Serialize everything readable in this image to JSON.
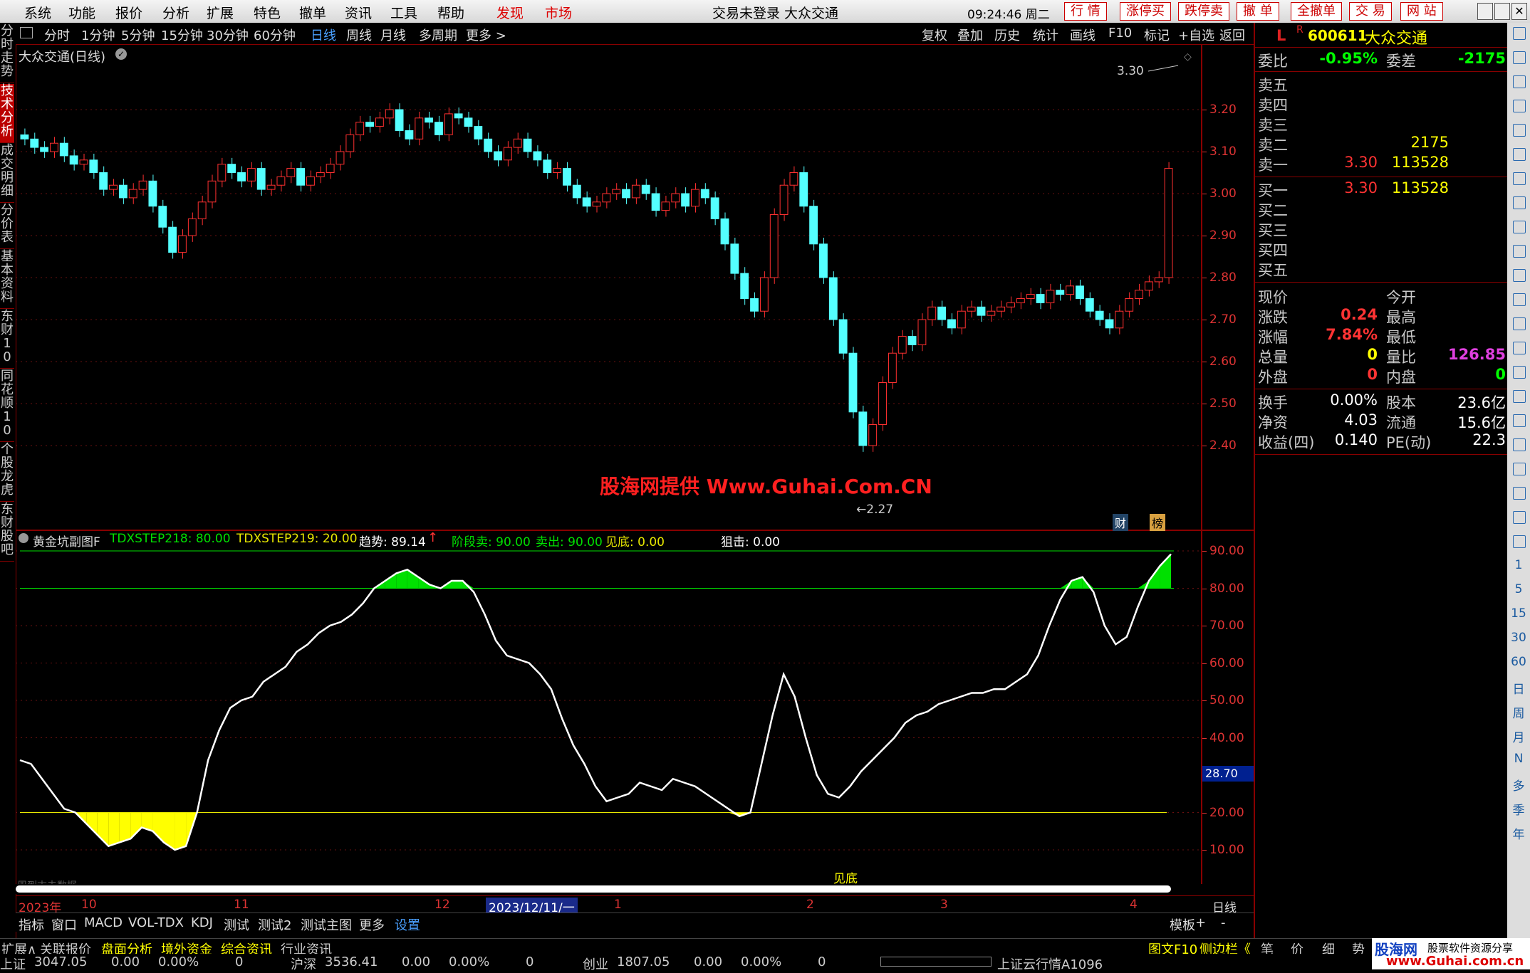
{
  "menu": {
    "items": [
      "系统",
      "功能",
      "报价",
      "分析",
      "扩展",
      "特色",
      "撤单",
      "资讯",
      "工具",
      "帮助"
    ],
    "highlight": [
      "发现",
      "市场"
    ],
    "title": "交易未登录  大众交通",
    "clock": "09:24:46 周二",
    "buttons": [
      "行 情",
      "涨停买",
      "跌停卖",
      "撤 单",
      "全撤单",
      "交 易",
      "网 站"
    ]
  },
  "left_nav": [
    "分时走势",
    "技术分析",
    "成交明细",
    "分价表",
    "基本资料",
    "东财10",
    "同花顺10",
    "个股龙虎",
    "东财股吧"
  ],
  "periods": [
    "分时",
    "1分钟",
    "5分钟",
    "15分钟",
    "30分钟",
    "60分钟",
    "日线",
    "周线",
    "月线",
    "多周期",
    "更多 >"
  ],
  "active_period": "日线",
  "chart_tools": [
    "复权",
    "叠加",
    "历史",
    "统计",
    "画线",
    "F10",
    "标记",
    "+自选",
    "返回"
  ],
  "main_chart": {
    "title": "大众交通(日线)",
    "high_label": "3.30",
    "low_label": "2.27",
    "watermark": "股海网提供 Www.Guhai.Com.CN",
    "badges": [
      "财",
      "榜"
    ],
    "price_ticks": [
      "3.20",
      "3.10",
      "3.00",
      "2.90",
      "2.80",
      "2.70",
      "2.60",
      "2.50",
      "2.40"
    ]
  },
  "indicator": {
    "name": "黄金坑副图F",
    "values": [
      {
        "label": "TDXSTEP218: 80.00",
        "color": "#00e000"
      },
      {
        "label": "TDXSTEP219: 20.00",
        "color": "#e8e800"
      },
      {
        "label": "趋势: 89.14",
        "color": "#ffffff"
      },
      {
        "label": "阶段卖: 90.00",
        "color": "#00e000"
      },
      {
        "label": "卖出: 90.00",
        "color": "#00e000"
      },
      {
        "label": "见底: 0.00",
        "color": "#e8e800"
      },
      {
        "label": "狙击: 0.00",
        "color": "#ffffff"
      }
    ],
    "ticks": [
      "90.00",
      "80.00",
      "70.00",
      "60.00",
      "50.00",
      "40.00",
      "20.00",
      "10.00"
    ],
    "current_value": "28.70",
    "signal_label": "见底",
    "faint_label": "周到末去数据"
  },
  "chart_data": {
    "type": "line",
    "series": [
      {
        "name": "趋势",
        "values": [
          34,
          33,
          29,
          25,
          21,
          20,
          17,
          14,
          11,
          12,
          13,
          16,
          15,
          12,
          10,
          11,
          20,
          34,
          42,
          48,
          50,
          51,
          55,
          57,
          59,
          63,
          65,
          68,
          70,
          71,
          73,
          76,
          80,
          82,
          84,
          85,
          83,
          81,
          80,
          82,
          82,
          79,
          73,
          66,
          62,
          61,
          60,
          57,
          53,
          45,
          38,
          33,
          27,
          23,
          24,
          25,
          28,
          27,
          26,
          29,
          28,
          27,
          25,
          23,
          21,
          19,
          20,
          33,
          46,
          57,
          51,
          40,
          30,
          25,
          24,
          27,
          31,
          34,
          37,
          40,
          44,
          46,
          47,
          49,
          50,
          51,
          52,
          52,
          53,
          53,
          55,
          57,
          62,
          70,
          77,
          82,
          83,
          79,
          70,
          65,
          67,
          75,
          82,
          86,
          89.14
        ]
      }
    ],
    "ylim": [
      0,
      100
    ],
    "reference_lines": [
      80,
      20,
      90
    ]
  },
  "time_axis": {
    "labels": [
      "2023年",
      "10",
      "11",
      "12",
      "2023/12/11/一",
      "1",
      "2",
      "3",
      "4"
    ],
    "period": "日线"
  },
  "bottom_tabs": [
    "指标",
    "窗口",
    "MACD",
    "VOL-TDX",
    "KDJ",
    "测试",
    "测试2",
    "测试主图",
    "更多",
    "设置"
  ],
  "bottom_right": [
    "模板",
    "+",
    "-"
  ],
  "quote": {
    "code": "600611",
    "name": "大众交通",
    "wei_bi": "-0.95%",
    "wei_cha": "-2175",
    "sell": [
      {
        "label": "卖五",
        "price": "",
        "vol": ""
      },
      {
        "label": "卖四",
        "price": "",
        "vol": ""
      },
      {
        "label": "卖三",
        "price": "",
        "vol": ""
      },
      {
        "label": "卖二",
        "price": "",
        "vol": "2175"
      },
      {
        "label": "卖一",
        "price": "3.30",
        "vol": "113528"
      }
    ],
    "buy": [
      {
        "label": "买一",
        "price": "3.30",
        "vol": "113528"
      },
      {
        "label": "买二",
        "price": "",
        "vol": ""
      },
      {
        "label": "买三",
        "price": "",
        "vol": ""
      },
      {
        "label": "买四",
        "price": "",
        "vol": ""
      },
      {
        "label": "买五",
        "price": "",
        "vol": ""
      }
    ],
    "stats": [
      {
        "l1": "现价",
        "v1": "",
        "l2": "今开",
        "v2": ""
      },
      {
        "l1": "涨跌",
        "v1": "0.24",
        "l2": "最高",
        "v2": ""
      },
      {
        "l1": "涨幅",
        "v1": "7.84%",
        "l2": "最低",
        "v2": ""
      },
      {
        "l1": "总量",
        "v1": "0",
        "l2": "量比",
        "v2": "126.85"
      },
      {
        "l1": "外盘",
        "v1": "0",
        "l2": "内盘",
        "v2": "0"
      }
    ],
    "stats2": [
      {
        "l1": "换手",
        "v1": "0.00%",
        "l2": "股本",
        "v2": "23.6亿"
      },
      {
        "l1": "净资",
        "v1": "4.03",
        "l2": "流通",
        "v2": "15.6亿"
      },
      {
        "l1": "收益(四)",
        "v1": "0.140",
        "l2": "PE(动)",
        "v2": "22.3"
      }
    ]
  },
  "status": {
    "tabs": [
      "扩展∧",
      "关联报价",
      "盘面分析",
      "境外资金",
      "综合资讯",
      "行业资讯"
    ],
    "right": [
      "图文F10",
      "侧边栏《",
      "笔",
      "价",
      "细",
      "势"
    ],
    "indices": [
      {
        "name": "上证",
        "val": "3047.05",
        "chg": "0.00",
        "pct": "0.00%",
        "vol": "0"
      },
      {
        "name": "沪深",
        "val": "3536.41",
        "chg": "0.00",
        "pct": "0.00%",
        "vol": "0"
      },
      {
        "name": "创业",
        "val": "1807.05",
        "chg": "0.00",
        "pct": "0.00%",
        "vol": "0"
      }
    ],
    "ticker": "上证云行情A1096",
    "logo": "股海网",
    "logo_sub": "股票软件资源分享",
    "logo_url": "www.Guhai.com.cn"
  },
  "right_toolbar": [
    "1",
    "5",
    "15",
    "30",
    "60",
    "日",
    "周",
    "月",
    "N",
    "多",
    "季",
    "年"
  ]
}
